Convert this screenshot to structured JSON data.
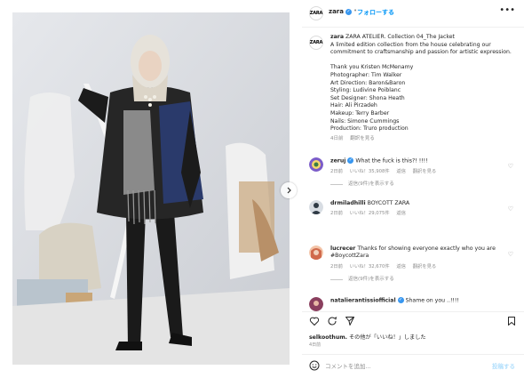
{
  "post": {
    "username": "zara",
    "avatar_text": "ZARA",
    "separator": "•",
    "follow_label": "フォローする",
    "more_label": "•••"
  },
  "caption": {
    "username": "zara",
    "lines": [
      "ZARA ATELIER. Collection 04_The Jacket",
      "A limited edition collection from the house celebrating our commitment to craftsmanship and passion for artistic expression.",
      "",
      "Thank you Kristen McMenamy",
      "Photographer: Tim Walker",
      "Art Direction: Baron&Baron",
      "Styling: Ludivine Poiblanc",
      "Set Designer: Shona Heath",
      "Hair: Ali Pirzadeh",
      "Makeup: Terry Barber",
      "Nails: Simone Cummings",
      "Production: Truro production"
    ],
    "time": "4日前",
    "translate": "翻訳を見る"
  },
  "comments": [
    {
      "username": "zeruj",
      "verified": true,
      "text": "What the fuck is this?! !!!!",
      "time": "2日前",
      "likes": "いいね！35,908件",
      "reply": "返信",
      "translate": "翻訳を見る",
      "replies": "返信(9件)を表示する",
      "avatar_color": "#7b5cc9"
    },
    {
      "username": "drmiladhilli",
      "verified": false,
      "text": "BOYCOTT ZARA",
      "time": "2日前",
      "likes": "いいね！29,075件",
      "reply": "返信",
      "translate": "",
      "replies": "",
      "avatar_color": "#2f3a45"
    },
    {
      "username": "lucrecer",
      "verified": false,
      "text": "Thanks for showing everyone exactly who you are #BoycottZara",
      "time": "2日前",
      "likes": "いいね！32,670件",
      "reply": "返信",
      "translate": "翻訳を見る",
      "replies": "返信(9件)を表示する",
      "avatar_color": "#d06a4c"
    },
    {
      "username": "natalierantissiofficial",
      "verified": true,
      "text": "Shame on you ..!!!!",
      "time": "",
      "likes": "",
      "reply": "",
      "translate": "",
      "replies": "",
      "avatar_color": "#8a3f5e"
    }
  ],
  "actions": [
    "heart-icon",
    "comment-icon",
    "share-icon",
    "bookmark-icon"
  ],
  "likes_line": {
    "user": "selkoothum.",
    "rest": "その他が「いいね！」しました"
  },
  "post_date": "4日前",
  "comment_box": {
    "placeholder": "コメントを追加...",
    "post_label": "投稿する"
  },
  "colors": {
    "link": "#0095f6",
    "verified": "#3897f0",
    "muted": "#8e8e8e"
  }
}
